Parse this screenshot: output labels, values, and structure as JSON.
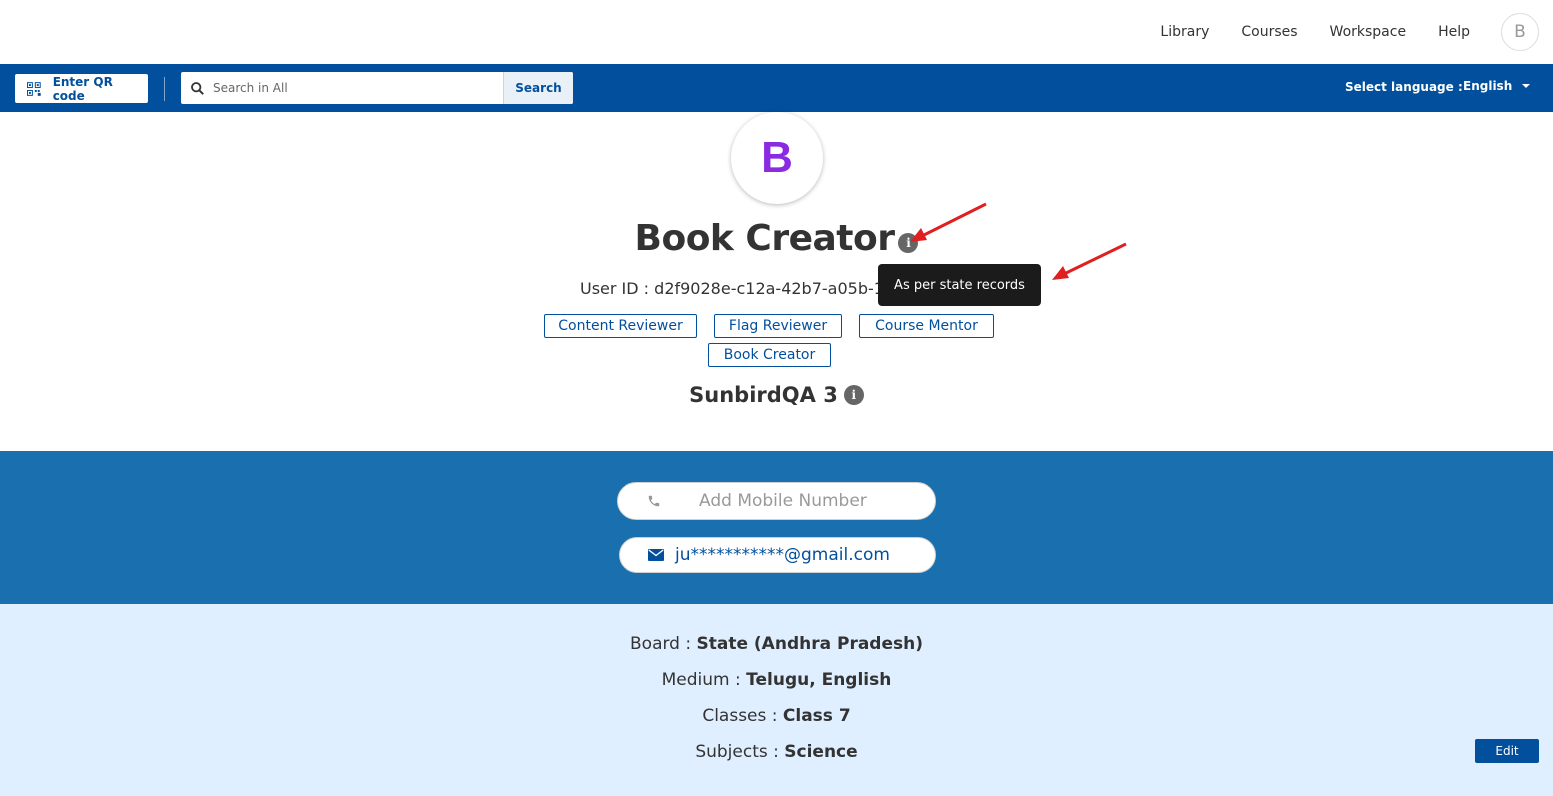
{
  "header": {
    "nav": [
      "Library",
      "Courses",
      "Workspace",
      "Help"
    ],
    "avatar_initial": "B"
  },
  "toolbar": {
    "qr_label": "Enter QR code",
    "search_placeholder": "Search in All",
    "search_button": "Search",
    "language_label": "Select language :",
    "language_value": "English"
  },
  "profile": {
    "avatar_initial": "B",
    "name": "Book Creator",
    "info_glyph": "i",
    "user_id": "User ID : d2f9028e-c12a-42b7-a05b-14",
    "tooltip": "As per state records",
    "roles": [
      "Content Reviewer",
      "Flag Reviewer",
      "Course Mentor",
      "Book Creator"
    ],
    "org_name": "SunbirdQA 3"
  },
  "contact": {
    "phone_placeholder": "Add Mobile Number",
    "email": "ju***********@gmail.com"
  },
  "framework": {
    "board_label": "Board :",
    "board_value": "State (Andhra Pradesh)",
    "medium_label": "Medium :",
    "medium_value": "Telugu, English",
    "classes_label": "Classes :",
    "classes_value": "Class 7",
    "subjects_label": "Subjects :",
    "subjects_value": "Science",
    "edit_label": "Edit"
  },
  "colors": {
    "brand_blue": "#024f9d",
    "contact_band": "#1a6fae",
    "framework_bg": "#e0efff",
    "avatar_letter": "#8a2be2",
    "annotation_arrow": "#e02020"
  }
}
